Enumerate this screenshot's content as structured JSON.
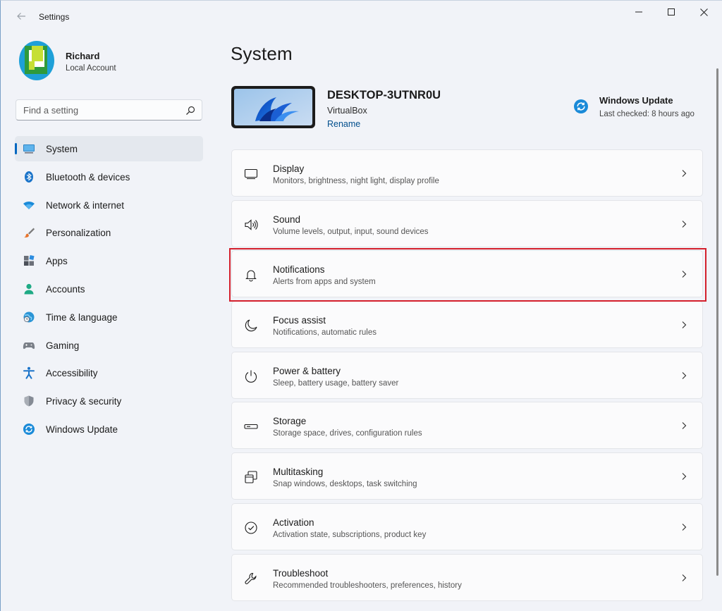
{
  "window": {
    "title": "Settings",
    "back_icon": "arrow-left-icon",
    "controls": [
      "minimize-icon",
      "maximize-icon",
      "close-icon"
    ]
  },
  "profile": {
    "name": "Richard",
    "account_type": "Local Account",
    "colors": {
      "outer": "#1ea0d8",
      "ring": "#2f9a3c",
      "inner": "#c6df34"
    }
  },
  "search": {
    "placeholder": "Find a setting",
    "value": "",
    "icon": "search-icon"
  },
  "sidebar": {
    "items": [
      {
        "label": "System",
        "icon": "monitor-icon",
        "active": true
      },
      {
        "label": "Bluetooth & devices",
        "icon": "bluetooth-icon"
      },
      {
        "label": "Network & internet",
        "icon": "wifi-icon"
      },
      {
        "label": "Personalization",
        "icon": "paintbrush-icon"
      },
      {
        "label": "Apps",
        "icon": "apps-icon"
      },
      {
        "label": "Accounts",
        "icon": "person-icon"
      },
      {
        "label": "Time & language",
        "icon": "globe-clock-icon"
      },
      {
        "label": "Gaming",
        "icon": "gamepad-icon"
      },
      {
        "label": "Accessibility",
        "icon": "accessibility-icon"
      },
      {
        "label": "Privacy & security",
        "icon": "shield-icon"
      },
      {
        "label": "Windows Update",
        "icon": "windows-update-icon"
      }
    ]
  },
  "main": {
    "title": "System",
    "device": {
      "name": "DESKTOP-3UTNR0U",
      "model": "VirtualBox",
      "rename_label": "Rename"
    },
    "windows_update": {
      "title": "Windows Update",
      "status": "Last checked: 8 hours ago",
      "icon": "sync-icon"
    },
    "cards": [
      {
        "title": "Display",
        "subtitle": "Monitors, brightness, night light, display profile",
        "icon": "display-icon"
      },
      {
        "title": "Sound",
        "subtitle": "Volume levels, output, input, sound devices",
        "icon": "speaker-icon"
      },
      {
        "title": "Notifications",
        "subtitle": "Alerts from apps and system",
        "icon": "bell-icon",
        "highlighted": true
      },
      {
        "title": "Focus assist",
        "subtitle": "Notifications, automatic rules",
        "icon": "moon-icon"
      },
      {
        "title": "Power & battery",
        "subtitle": "Sleep, battery usage, battery saver",
        "icon": "power-icon"
      },
      {
        "title": "Storage",
        "subtitle": "Storage space, drives, configuration rules",
        "icon": "storage-icon"
      },
      {
        "title": "Multitasking",
        "subtitle": "Snap windows, desktops, task switching",
        "icon": "multitasking-icon"
      },
      {
        "title": "Activation",
        "subtitle": "Activation state, subscriptions, product key",
        "icon": "checkmark-circle-icon"
      },
      {
        "title": "Troubleshoot",
        "subtitle": "Recommended troubleshooters, preferences, history",
        "icon": "wrench-icon"
      }
    ],
    "highlight_color": "#d4202c"
  },
  "accent_color": "#0067c0"
}
